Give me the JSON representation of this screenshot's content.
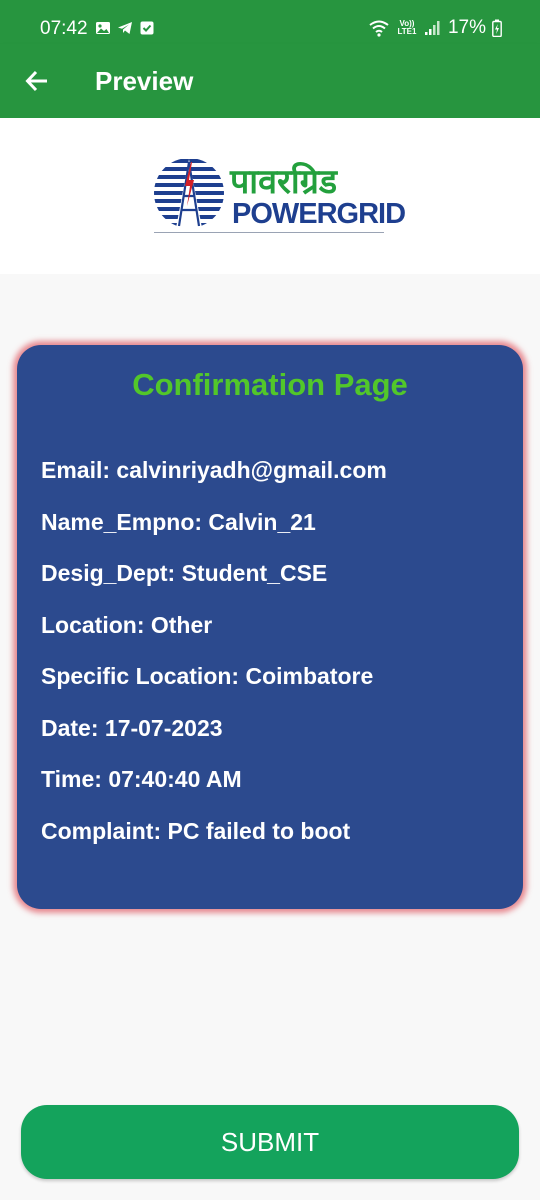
{
  "status_bar": {
    "time": "07:42",
    "network_label": "Vo)) LTE1",
    "battery": "17%"
  },
  "app_bar": {
    "title": "Preview"
  },
  "logo": {
    "hindi": "पावरग्रिड",
    "english": "POWERGRID"
  },
  "card": {
    "title": "Confirmation Page",
    "lines": [
      "Email: calvinriyadh@gmail.com",
      "Name_Empno: Calvin_21",
      "Desig_Dept: Student_CSE",
      "Location: Other",
      "Specific Location: Coimbatore",
      "Date: 17-07-2023",
      "Time: 07:40:40 AM",
      "Complaint: PC failed to boot"
    ]
  },
  "submit_label": "SUBMIT",
  "colors": {
    "app_bar": "#27953f",
    "card": "#2c4a8e",
    "card_title": "#52c72a",
    "card_glow": "#e2646e",
    "submit": "#14a35c"
  }
}
